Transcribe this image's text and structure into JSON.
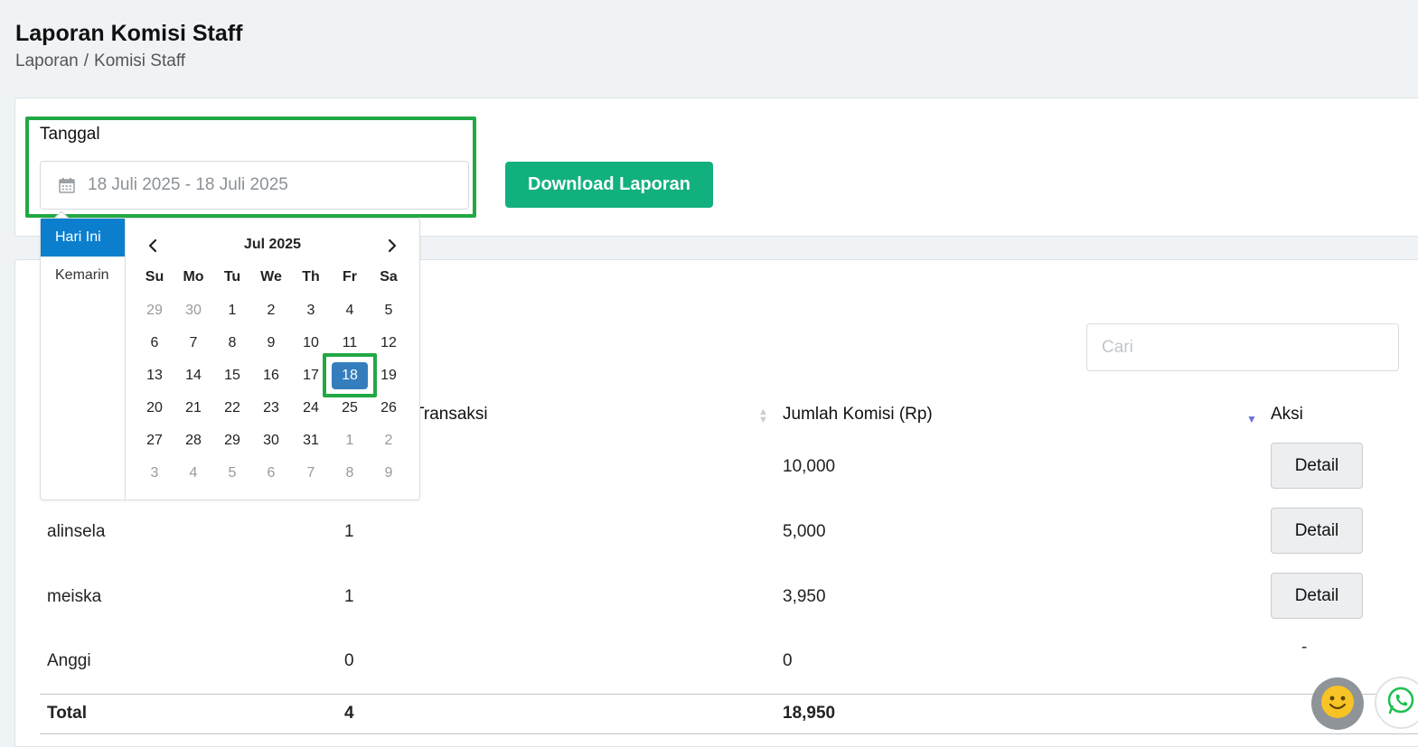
{
  "page": {
    "title": "Laporan Komisi Staff",
    "breadcrumb": [
      "Laporan",
      "Komisi Staff"
    ],
    "breadcrumb_sep": "/"
  },
  "filter": {
    "date_label": "Tanggal",
    "date_value": "18 Juli 2025 - 18 Juli 2025",
    "download_label": "Download Laporan"
  },
  "search": {
    "placeholder": "Cari"
  },
  "table": {
    "headers": {
      "transaksi": "Transaksi",
      "komisi": "Jumlah Komisi (Rp)",
      "aksi": "Aksi"
    },
    "rows": [
      {
        "name": "",
        "transaksi": "",
        "komisi": "10,000",
        "aksi": "Detail"
      },
      {
        "name": "alinsela",
        "transaksi": "1",
        "komisi": "5,000",
        "aksi": "Detail"
      },
      {
        "name": "meiska",
        "transaksi": "1",
        "komisi": "3,950",
        "aksi": "Detail"
      },
      {
        "name": "Anggi",
        "transaksi": "0",
        "komisi": "0",
        "aksi": "-"
      }
    ],
    "total": {
      "label": "Total",
      "transaksi": "4",
      "komisi": "18,950"
    }
  },
  "datepicker": {
    "ranges": [
      "Hari Ini",
      "Kemarin"
    ],
    "active_range": "Hari Ini",
    "month": "Jul 2025",
    "weekdays": [
      "Su",
      "Mo",
      "Tu",
      "We",
      "Th",
      "Fr",
      "Sa"
    ],
    "weeks": [
      [
        "29",
        "30",
        "1",
        "2",
        "3",
        "4",
        "5"
      ],
      [
        "6",
        "7",
        "8",
        "9",
        "10",
        "11",
        "12"
      ],
      [
        "13",
        "14",
        "15",
        "16",
        "17",
        "18",
        "19"
      ],
      [
        "20",
        "21",
        "22",
        "23",
        "24",
        "25",
        "26"
      ],
      [
        "27",
        "28",
        "29",
        "30",
        "31",
        "1",
        "2"
      ],
      [
        "3",
        "4",
        "5",
        "6",
        "7",
        "8",
        "9"
      ]
    ],
    "selected_day": "18"
  },
  "colors": {
    "accent_green": "#12b07e",
    "highlight_green": "#22a843",
    "range_active": "#0b7fce",
    "day_selected": "#357ebd",
    "sort_active": "#6b73d8"
  },
  "icons": [
    "calendar-icon",
    "chevron-left-icon",
    "chevron-right-icon",
    "sort-icon",
    "sort-down-icon",
    "smiley-icon",
    "whatsapp-icon"
  ]
}
